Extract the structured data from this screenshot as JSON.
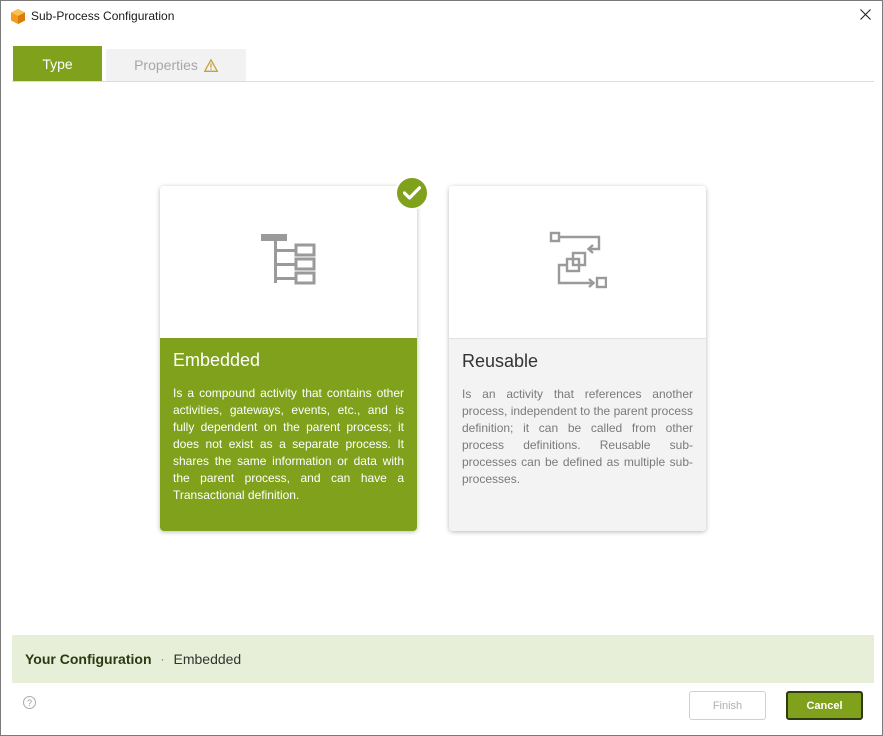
{
  "window": {
    "title": "Sub-Process Configuration",
    "app_icon": "app-cube-icon",
    "close_icon": "close-icon"
  },
  "tabs": [
    {
      "label": "Type",
      "active": true
    },
    {
      "label": "Properties",
      "active": false,
      "icon": "warning-icon"
    }
  ],
  "cards": {
    "embedded": {
      "title": "Embedded",
      "description": "Is a compound activity that contains other activities, gateways, events, etc., and is fully dependent on the parent process; it does not exist as a separate process. It shares the same information or data with the parent process, and can have a Transactional definition.",
      "icon": "hierarchy-tree-icon",
      "selected": true
    },
    "reusable": {
      "title": "Reusable",
      "description": "Is an activity that references another process, independent to the parent process definition; it can be called from other process definitions. Reusable sub-processes can be defined as multiple sub-processes.",
      "icon": "process-flow-icon",
      "selected": false
    }
  },
  "configuration": {
    "label": "Your Configuration",
    "separator": "·",
    "value": "Embedded"
  },
  "footer": {
    "help_label": "?",
    "finish_label": "Finish",
    "cancel_label": "Cancel"
  },
  "colors": {
    "accent": "#7fa11c",
    "config_bg": "#e8efd8",
    "warning": "#c8a13c"
  }
}
